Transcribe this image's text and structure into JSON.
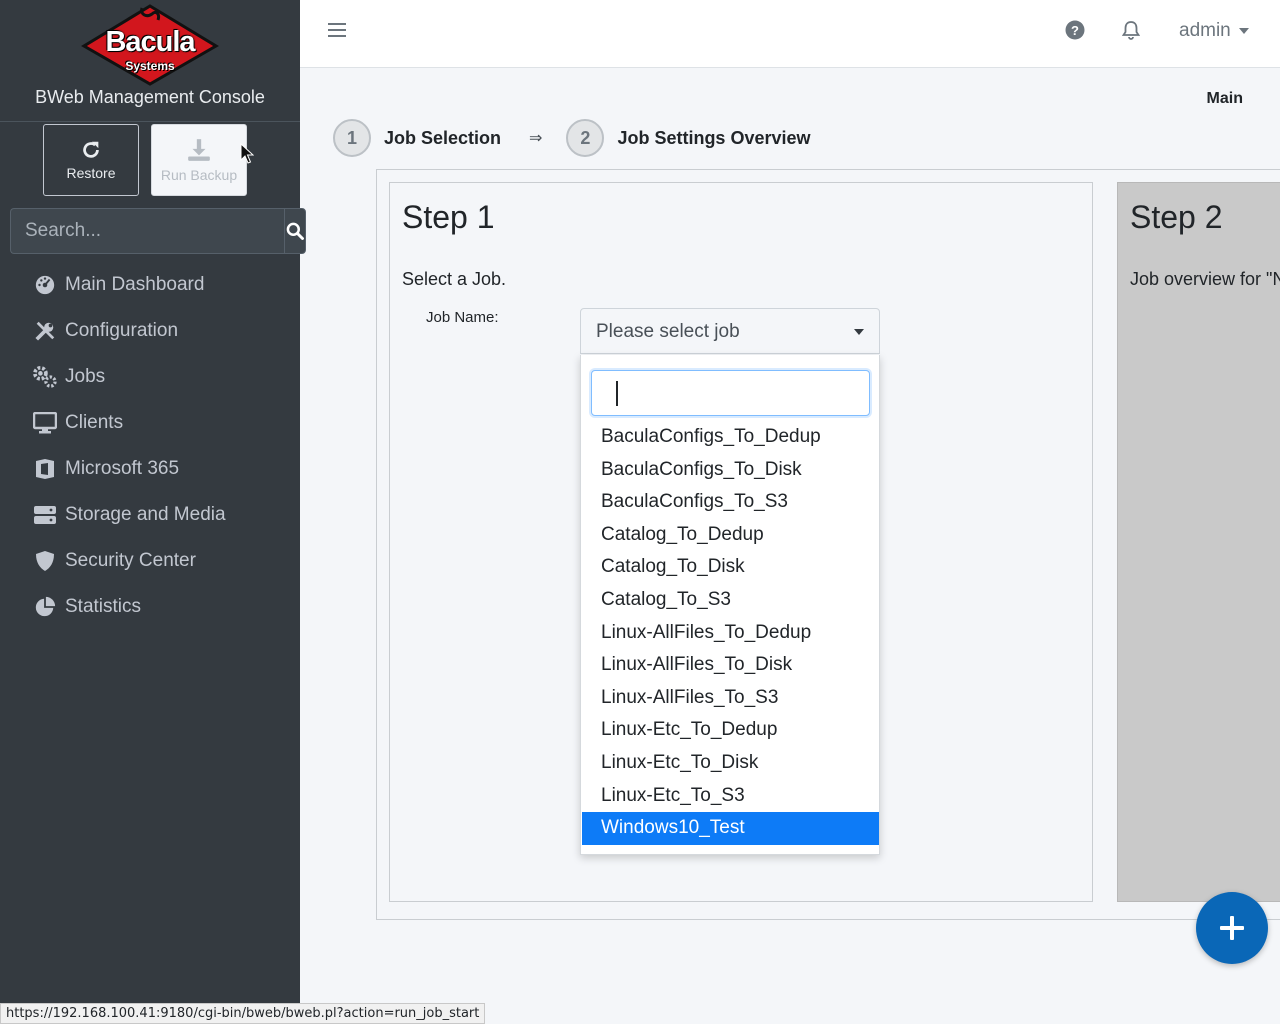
{
  "brand": {
    "logo_text": "Bacula",
    "logo_subtext": "Systems",
    "title": "BWeb Management Console"
  },
  "actions": {
    "restore_label": "Restore",
    "run_backup_label": "Run Backup"
  },
  "search": {
    "placeholder": "Search..."
  },
  "nav": [
    {
      "label": "Main Dashboard",
      "icon": "dashboard-icon"
    },
    {
      "label": "Configuration",
      "icon": "tools-icon"
    },
    {
      "label": "Jobs",
      "icon": "cogs-icon"
    },
    {
      "label": "Clients",
      "icon": "desktop-icon"
    },
    {
      "label": "Microsoft 365",
      "icon": "microsoft-icon"
    },
    {
      "label": "Storage and Media",
      "icon": "hdd-icon"
    },
    {
      "label": "Security Center",
      "icon": "shield-icon"
    },
    {
      "label": "Statistics",
      "icon": "pie-chart-icon"
    }
  ],
  "topbar": {
    "user": "admin"
  },
  "breadcrumb": "Main",
  "stepper": [
    {
      "number": "1",
      "label": "Job Selection"
    },
    {
      "number": "2",
      "label": "Job Settings Overview"
    }
  ],
  "step_arrow": "⇒",
  "step1": {
    "title": "Step 1",
    "subtitle": "Select a Job.",
    "job_name_label": "Job Name:",
    "select_placeholder": "Please select job"
  },
  "step2": {
    "title": "Step 2",
    "subtitle": "Job overview for \"N"
  },
  "dropdown": {
    "search_value": "",
    "selected_index": 12,
    "options": [
      "BaculaConfigs_To_Dedup",
      "BaculaConfigs_To_Disk",
      "BaculaConfigs_To_S3",
      "Catalog_To_Dedup",
      "Catalog_To_Disk",
      "Catalog_To_S3",
      "Linux-AllFiles_To_Dedup",
      "Linux-AllFiles_To_Disk",
      "Linux-AllFiles_To_S3",
      "Linux-Etc_To_Dedup",
      "Linux-Etc_To_Disk",
      "Linux-Etc_To_S3",
      "Windows10_Test"
    ]
  },
  "status_url": "https://192.168.100.41:9180/cgi-bin/bweb/bweb.pl?action=run_job_start",
  "colors": {
    "sidebar": "#343a40",
    "accent": "#0d7bf7",
    "fab": "#0a67b7",
    "logo_red": "#d2161d"
  }
}
